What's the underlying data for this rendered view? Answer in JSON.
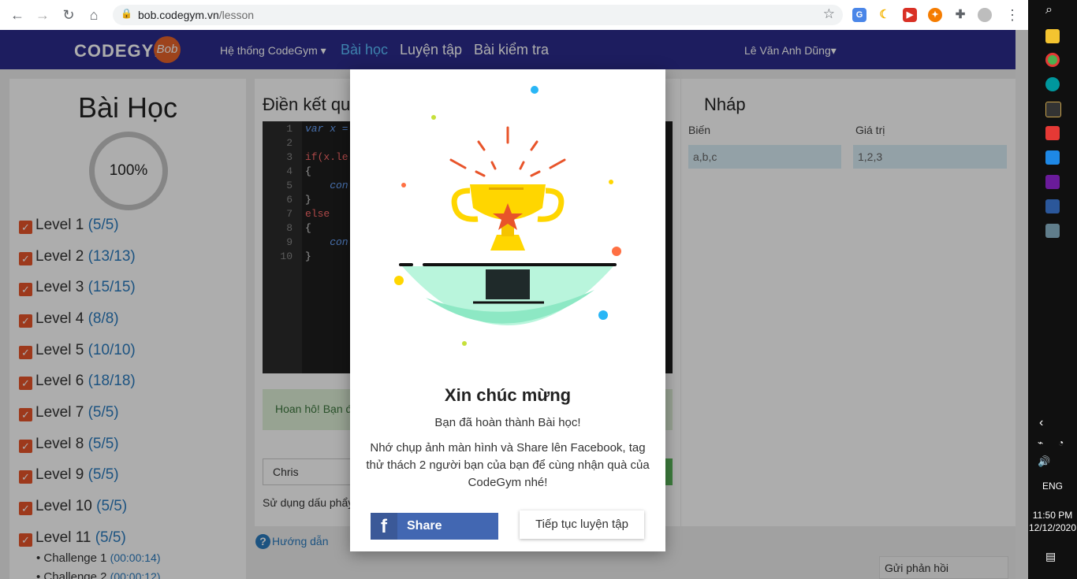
{
  "browser": {
    "url_host": "bob.codegym.vn",
    "url_path": "/lesson"
  },
  "navbar": {
    "logo": "CODEGYM",
    "logo_badge": "Bob",
    "menu_system": "Hệ thống CodeGym",
    "menu_lessons": "Bài học",
    "menu_practice": "Luyện tập",
    "menu_tests": "Bài kiểm tra",
    "user": "Lê Văn Anh Dũng"
  },
  "sidebar": {
    "title": "Bài Học",
    "progress": "100%",
    "levels": [
      {
        "label": "Level 1",
        "count": "(5/5)"
      },
      {
        "label": "Level 2",
        "count": "(13/13)"
      },
      {
        "label": "Level 3",
        "count": "(15/15)"
      },
      {
        "label": "Level 4",
        "count": "(8/8)"
      },
      {
        "label": "Level 5",
        "count": "(10/10)"
      },
      {
        "label": "Level 6",
        "count": "(18/18)"
      },
      {
        "label": "Level 7",
        "count": "(5/5)"
      },
      {
        "label": "Level 8",
        "count": "(5/5)"
      },
      {
        "label": "Level 9",
        "count": "(5/5)"
      },
      {
        "label": "Level 10",
        "count": "(5/5)"
      },
      {
        "label": "Level 11",
        "count": "(5/5)"
      }
    ],
    "challenges": [
      {
        "label": "Challenge 1",
        "time": "(00:00:14)"
      },
      {
        "label": "Challenge 2",
        "time": "(00:00:12)"
      }
    ]
  },
  "main": {
    "title": "Điền kết qu",
    "line_numbers": [
      "1",
      "2",
      "3",
      "4",
      "5",
      "6",
      "7",
      "8",
      "9",
      "10"
    ],
    "code": {
      "l1": "var x =",
      "l3": "if(x.le",
      "l4": "{",
      "l5": "    con",
      "l6": "}",
      "l7": "else",
      "l8": "{",
      "l9": "    con",
      "l10": "}"
    },
    "success_text": "Hoan hô! Bạn đ",
    "input_value": "Chris",
    "hint": "Sử dụng dấu phẩy",
    "guide": "Hướng dẫn"
  },
  "draft": {
    "title": "Nháp",
    "col_var": "Biến",
    "col_val": "Giá trị",
    "var_value": "a,b,c",
    "val_value": "1,2,3"
  },
  "feedback": "Gửi phản hồi",
  "modal": {
    "title": "Xin chúc mừng",
    "subtitle": "Bạn đã hoàn thành Bài học!",
    "body": "Nhớ chụp ảnh màn hình và Share lên Facebook, tag thử thách 2 người bạn của bạn để cùng nhận quà của CodeGym nhé!",
    "share": "Share",
    "continue": "Tiếp tục luyện tập"
  },
  "taskbar": {
    "lang": "ENG",
    "time": "11:50 PM",
    "date": "12/12/2020"
  }
}
